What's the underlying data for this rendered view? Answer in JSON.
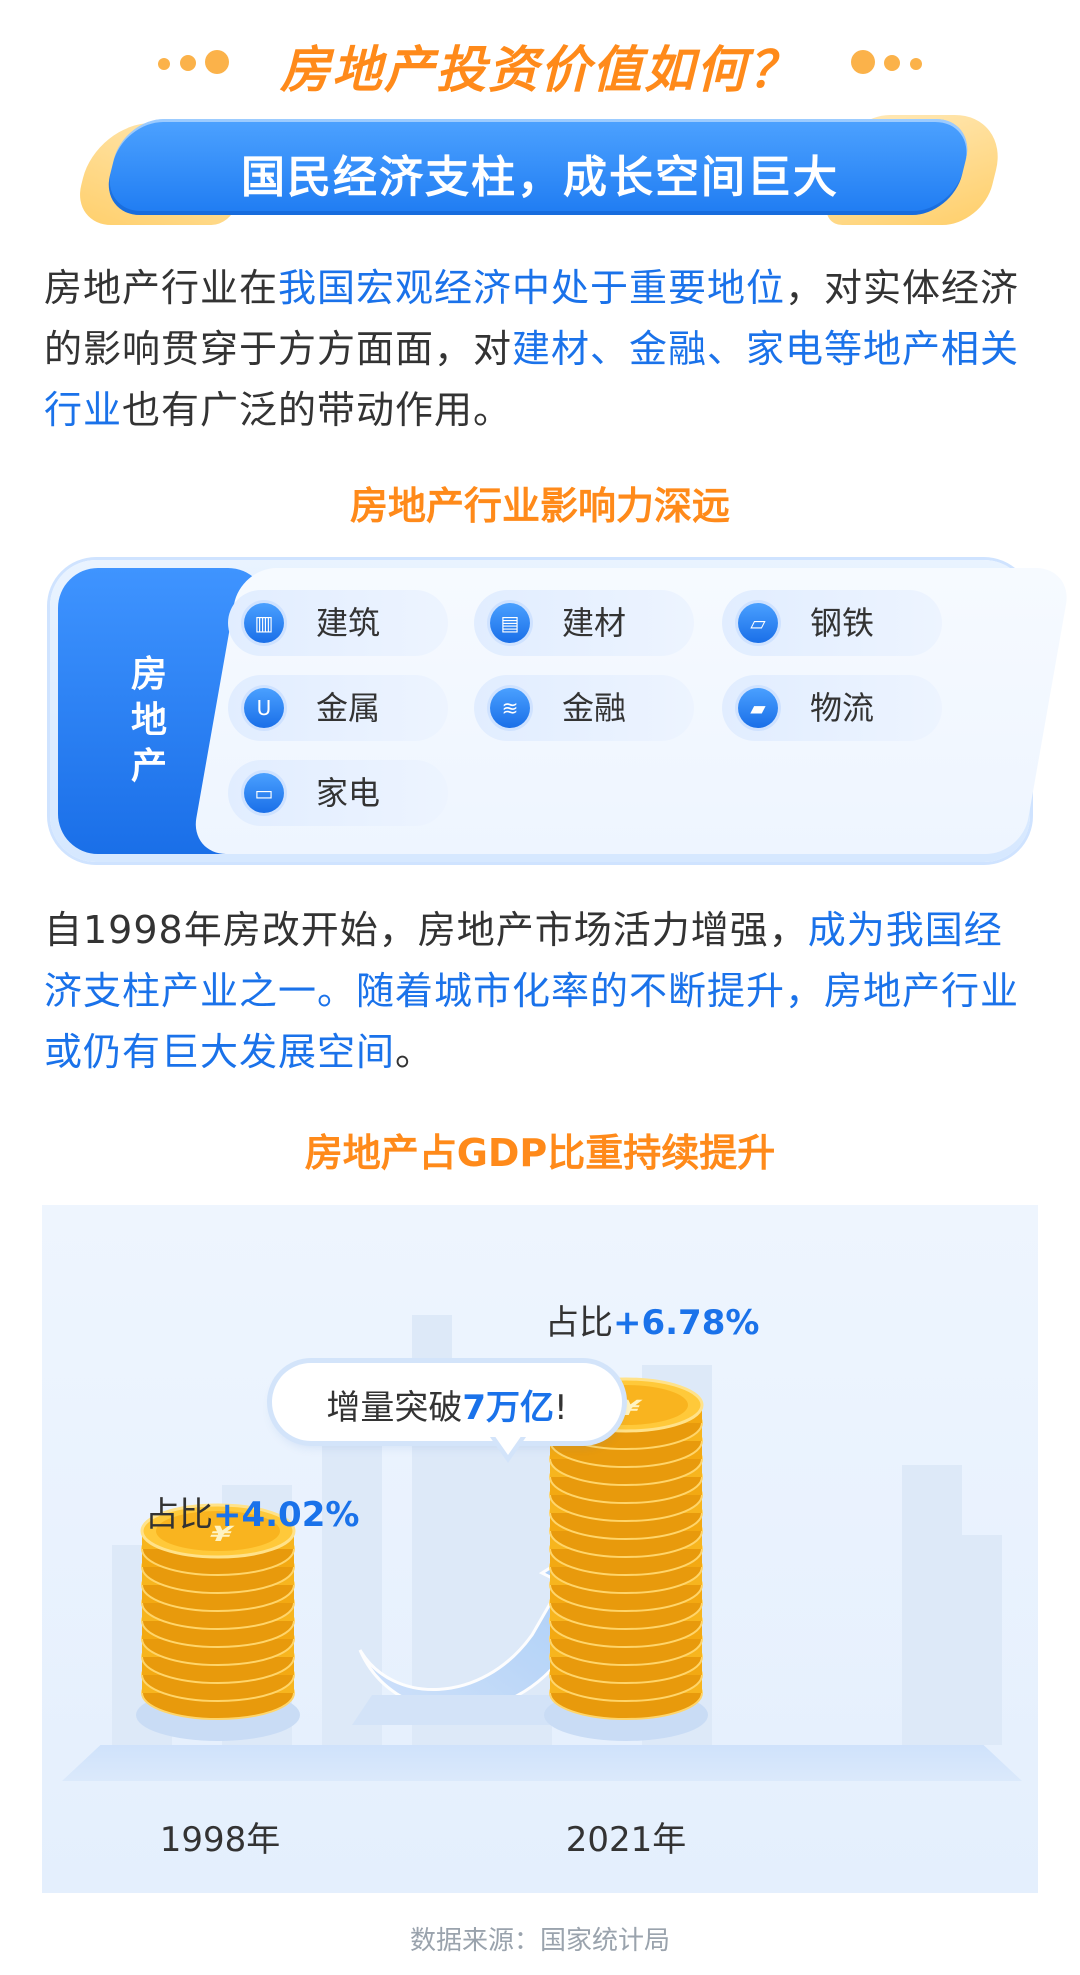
{
  "title": "房地产投资价值如何？",
  "banner": "国民经济支柱，成长空间巨大",
  "intro": {
    "segments": [
      {
        "text": "房地产行业在",
        "highlight": false
      },
      {
        "text": "我国宏观经济中处于重要地位",
        "highlight": true
      },
      {
        "text": "，对实体经济的影响贯穿于方方面面，对",
        "highlight": false
      },
      {
        "text": "建材、金融、家电等地产相关行业",
        "highlight": true
      },
      {
        "text": "也有广泛的带动作用。",
        "highlight": false
      }
    ]
  },
  "influence": {
    "title": "房地产行业影响力深远",
    "label": "房地产",
    "items": [
      {
        "label": "建筑",
        "icon": "building-icon",
        "glyph": "▥"
      },
      {
        "label": "建材",
        "icon": "materials-icon",
        "glyph": "▤"
      },
      {
        "label": "钢铁",
        "icon": "steel-icon",
        "glyph": "▱"
      },
      {
        "label": "金属",
        "icon": "magnet-icon",
        "glyph": "U"
      },
      {
        "label": "金融",
        "icon": "coins-icon",
        "glyph": "≋"
      },
      {
        "label": "物流",
        "icon": "truck-icon",
        "glyph": "▰"
      },
      {
        "label": "家电",
        "icon": "appliance-icon",
        "glyph": "▭"
      }
    ]
  },
  "growth": {
    "segments": [
      {
        "text": "自1998年房改开始，房地产市场活力增强，",
        "highlight": false
      },
      {
        "text": "成为我国经济支柱产业之一。随着城市化率的不断提升，房地产行业或仍有巨大发展空间",
        "highlight": true
      },
      {
        "text": "。",
        "highlight": false
      }
    ]
  },
  "gdp": {
    "title": "房地产占GDP比重持续提升",
    "bubble_prefix": "增量突破",
    "bubble_value": "7万亿",
    "bubble_suffix": "!",
    "points": [
      {
        "year": "1998年",
        "prefix": "占比",
        "value": "+4.02%",
        "share": 4.02
      },
      {
        "year": "2021年",
        "prefix": "占比",
        "value": "+6.78%",
        "share": 6.78
      }
    ]
  },
  "source": "数据来源：国家统计局",
  "colors": {
    "blue": "#1a72ea",
    "orange": "#ff8a1a",
    "coin": "#f7b21c"
  }
}
